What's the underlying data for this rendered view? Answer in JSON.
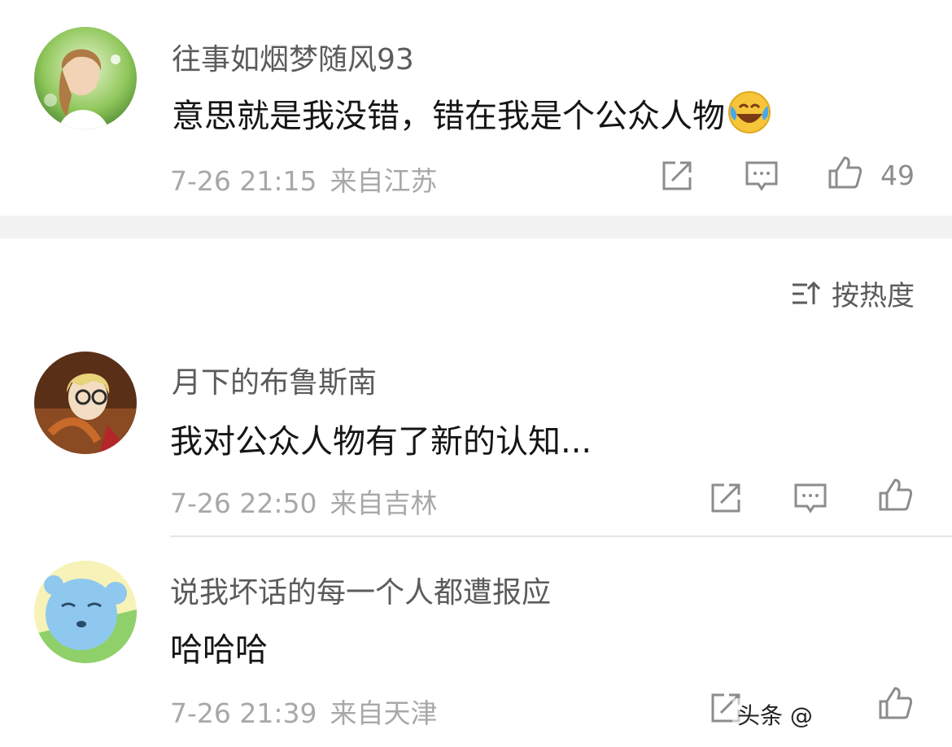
{
  "comments": [
    {
      "username": "往事如烟梦随风93",
      "text": "意思就是我没错，错在我是个公众人物",
      "emoji_icon": "laughing-crying-emoji",
      "date": "7-26 21:15",
      "location": "来自江苏",
      "likes": "49"
    },
    {
      "username": "月下的布鲁斯南",
      "text": "我对公众人物有了新的认知...",
      "date": "7-26 22:50",
      "location": "来自吉林"
    },
    {
      "username": "说我坏话的每一个人都遭报应",
      "text": "哈哈哈",
      "date": "7-26 21:39",
      "location": "来自天津"
    }
  ],
  "sort": {
    "label": "按热度",
    "icon": "sort-icon"
  },
  "watermark": "头条 @",
  "colors": {
    "text": "#151515",
    "meta": "#a8a8a8",
    "divider": "#f2f2f2"
  }
}
